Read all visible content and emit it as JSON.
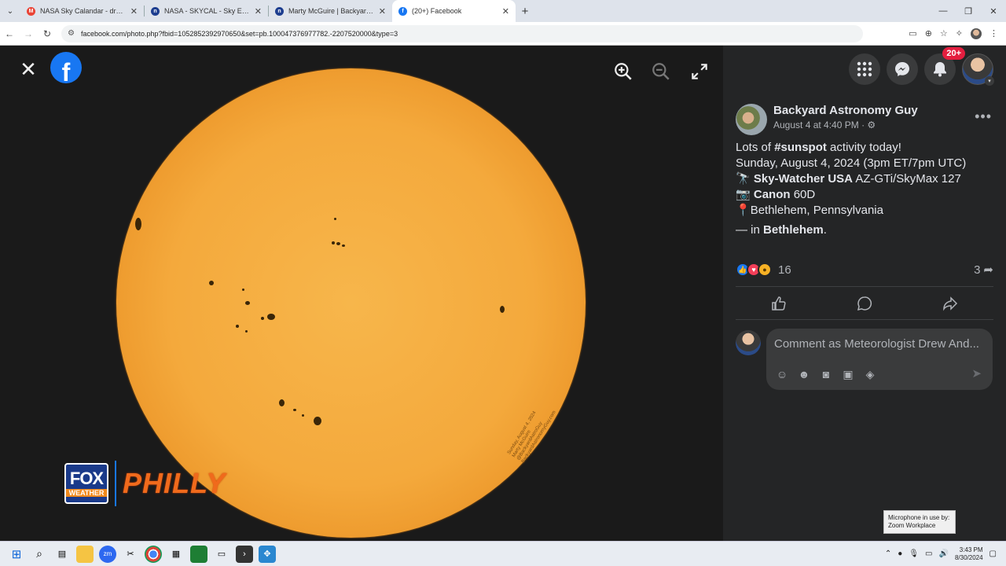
{
  "browser": {
    "tabs": [
      {
        "title": "NASA Sky Calandar - drewande",
        "favicon": "gmail-icon",
        "active": false
      },
      {
        "title": "NASA - SKYCAL - Sky Events Ca",
        "favicon": "nasa-icon",
        "active": false
      },
      {
        "title": "Marty McGuire | Backyard Astro",
        "favicon": "nasa-icon",
        "active": false
      },
      {
        "title": "(20+) Facebook",
        "favicon": "facebook-icon",
        "active": true
      }
    ],
    "url": "facebook.com/photo.php?fbid=1052852392970650&set=pb.100047376977782.-2207520000&type=3"
  },
  "viewer": {
    "logo_lower_word": "WEATHER",
    "logo_upper_word": "FOX",
    "logo_wordmark": "PHILLY",
    "watermark_lines": [
      "Sunday, August 4, 2024",
      "Marty McGuire",
      "@BackyardAstroGuy",
      "BackyardAstronomyGuy.com"
    ]
  },
  "header": {
    "notifications_badge": "20+"
  },
  "post": {
    "author": "Backyard Astronomy Guy",
    "date": "August 4 at 4:40 PM",
    "date_sep": " · ",
    "line1_pre": "Lots of ",
    "line1_tag": "#sunspot",
    "line1_post": " activity today!",
    "line2": "Sunday, August 4, 2024 (3pm ET/7pm UTC)",
    "line3_bold": "Sky-Watcher USA",
    "line3_rest": " AZ-GTi/SkyMax 127",
    "line4_bold": "Canon",
    "line4_rest": " 60D",
    "line5": "Bethlehem, Pennsylvania",
    "tag_pre": "— in ",
    "tag_place": "Bethlehem",
    "tag_post": ".",
    "reaction_count": "16",
    "share_count": "3"
  },
  "comment": {
    "placeholder": "Comment as Meteorologist Drew And..."
  },
  "tooltip": {
    "line1": "Microphone in use by:",
    "line2": "Zoom Workplace"
  },
  "taskbar": {
    "time": "3:43 PM",
    "date": "8/30/2024"
  }
}
